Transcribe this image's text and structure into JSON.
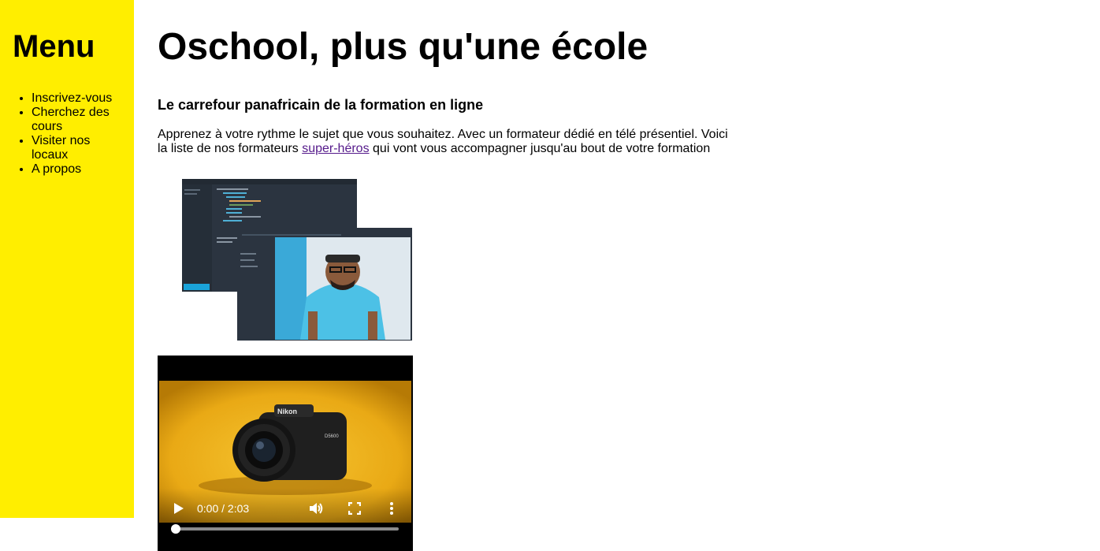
{
  "sidebar": {
    "title": "Menu",
    "items": [
      {
        "label": "Inscrivez-vous"
      },
      {
        "label": "Cherchez des cours"
      },
      {
        "label": "Visiter nos locaux"
      },
      {
        "label": "A propos"
      }
    ]
  },
  "main": {
    "title": "Oschool, plus qu'une école",
    "subtitle": "Le carrefour panafricain de la formation en ligne",
    "intro_before_link": "Apprenez à votre rythme le sujet que vous souhaitez. Avec un formateur dédié en télé présentiel. Voici la liste de nos formateurs ",
    "intro_link": "super-héros",
    "intro_after_link": " qui vont vous accompagner jusqu'au bout de votre formation"
  },
  "video": {
    "time": "0:00 / 2:03",
    "progress": 0,
    "brand_text": "Nikon",
    "model_text": "D5600"
  },
  "colors": {
    "sidebar_bg": "#ffee00",
    "link_visited": "#551a8b",
    "video_bg": "#f2b80f"
  }
}
